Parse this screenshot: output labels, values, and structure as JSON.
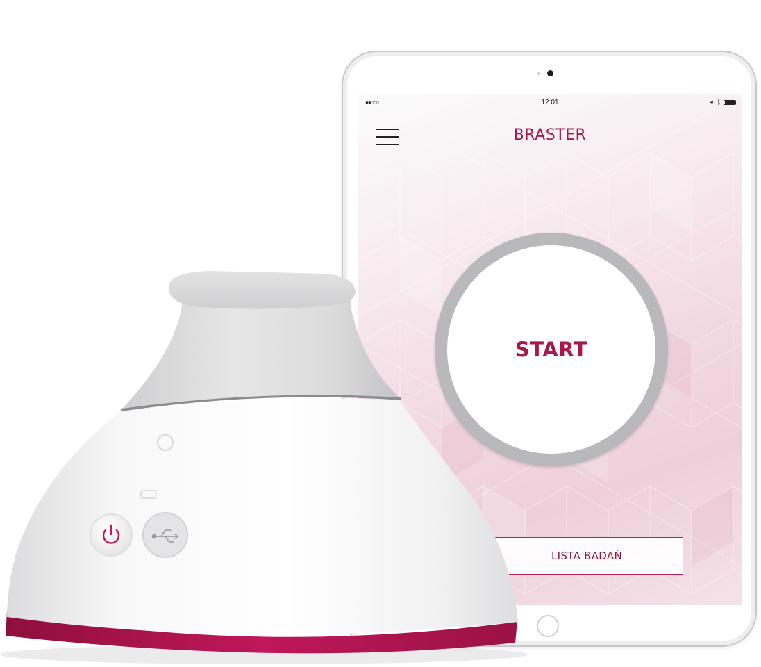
{
  "status_bar": {
    "signal": "●●○○○",
    "time": "12:01",
    "location_glyph": "➤",
    "bluetooth_glyph": "ᛒ"
  },
  "app": {
    "title": "BRASTER",
    "start_label": "START",
    "list_label": "LISTA BADAŃ"
  },
  "device": {
    "power_icon": "power-icon",
    "usb_icon": "usb-icon"
  },
  "colors": {
    "brand": "#a8174d",
    "device_base": "#b0154f"
  }
}
